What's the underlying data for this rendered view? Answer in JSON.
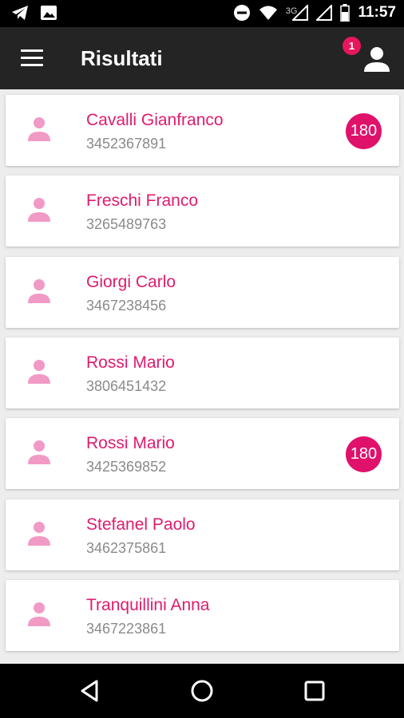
{
  "status_bar": {
    "network_label": "3G",
    "time": "11:57",
    "icons": [
      "telegram-icon",
      "image-icon",
      "do-not-disturb-icon",
      "wifi-icon",
      "signal-icon",
      "signal-icon",
      "battery-icon"
    ]
  },
  "app_bar": {
    "title": "Risultati",
    "notification_count": "1"
  },
  "colors": {
    "accent": "#e01b6f",
    "appbar": "#242424",
    "avatar": "#f19ac6"
  },
  "contacts": [
    {
      "name": "Cavalli Gianfranco",
      "phone": "3452367891",
      "badge": "180"
    },
    {
      "name": "Freschi Franco",
      "phone": "3265489763"
    },
    {
      "name": "Giorgi Carlo",
      "phone": "3467238456"
    },
    {
      "name": "Rossi Mario",
      "phone": "3806451432"
    },
    {
      "name": "Rossi Mario",
      "phone": "3425369852",
      "badge": "180"
    },
    {
      "name": "Stefanel Paolo",
      "phone": "3462375861"
    },
    {
      "name": "Tranquillini Anna",
      "phone": "3467223861"
    }
  ],
  "nav_bar": {
    "icons": [
      "back-icon",
      "home-icon",
      "recents-icon"
    ]
  }
}
